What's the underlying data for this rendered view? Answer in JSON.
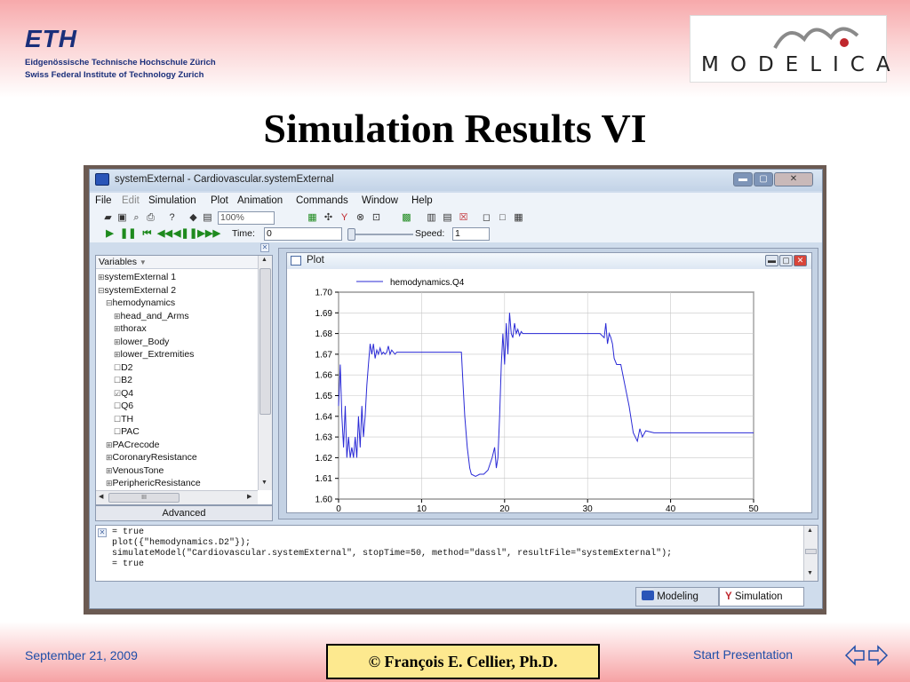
{
  "header": {
    "eth_logo": "ETH",
    "eth_line1": "Eidgenössische Technische Hochschule Zürich",
    "eth_line2": "Swiss Federal Institute of Technology Zurich",
    "modelica_logo": "MODELICA"
  },
  "slide_title": "Simulation Results VI",
  "window": {
    "title": "systemExternal - Cardiovascular.systemExternal",
    "menu": [
      "File",
      "Edit",
      "Simulation",
      "Plot",
      "Animation",
      "Commands",
      "Window",
      "Help"
    ],
    "disabled_menu": "Edit",
    "zoom": "100%",
    "time_label": "Time:",
    "time_value": "0",
    "speed_label": "Speed:",
    "speed_value": "1"
  },
  "variables": {
    "header": "Variables",
    "rows": [
      {
        "label": "systemExternal 1",
        "indent": 0,
        "prefix": "⊞"
      },
      {
        "label": "systemExternal 2",
        "indent": 0,
        "prefix": "⊟"
      },
      {
        "label": "hemodynamics",
        "indent": 1,
        "prefix": "⊟"
      },
      {
        "label": "head_and_Arms",
        "indent": 2,
        "prefix": "⊞"
      },
      {
        "label": "thorax",
        "indent": 2,
        "prefix": "⊞"
      },
      {
        "label": "lower_Body",
        "indent": 2,
        "prefix": "⊞"
      },
      {
        "label": "lower_Extremities",
        "indent": 2,
        "prefix": "⊞"
      },
      {
        "label": "D2",
        "indent": 2,
        "prefix": "☐"
      },
      {
        "label": "B2",
        "indent": 2,
        "prefix": "☐"
      },
      {
        "label": "Q4",
        "indent": 2,
        "prefix": "☑"
      },
      {
        "label": "Q6",
        "indent": 2,
        "prefix": "☐"
      },
      {
        "label": "TH",
        "indent": 2,
        "prefix": "☐"
      },
      {
        "label": "PAC",
        "indent": 2,
        "prefix": "☐"
      },
      {
        "label": "PACrecode",
        "indent": 1,
        "prefix": "⊞"
      },
      {
        "label": "CoronaryResistance",
        "indent": 1,
        "prefix": "⊞"
      },
      {
        "label": "VenousTone",
        "indent": 1,
        "prefix": "⊞"
      },
      {
        "label": "PeriphericResistance",
        "indent": 1,
        "prefix": "⊞"
      }
    ],
    "hscroll_glyph": "III",
    "advanced_label": "Advanced"
  },
  "plot": {
    "window_title": "Plot"
  },
  "chart_data": {
    "type": "line",
    "series": [
      {
        "name": "hemodynamics.Q4",
        "color": "#2a2ad6",
        "x": [
          0,
          0.2,
          0.4,
          0.6,
          0.8,
          1.0,
          1.2,
          1.4,
          1.6,
          1.8,
          2.0,
          2.2,
          2.4,
          2.6,
          2.8,
          3.0,
          3.2,
          3.4,
          3.6,
          3.8,
          4.0,
          4.2,
          4.4,
          4.6,
          4.8,
          5.0,
          5.2,
          5.4,
          5.6,
          5.8,
          6.0,
          6.2,
          6.4,
          6.6,
          6.8,
          7.0,
          7.5,
          8.0,
          9.0,
          10.0,
          11.0,
          12.0,
          13.0,
          14.0,
          14.8,
          15.0,
          15.2,
          15.5,
          15.8,
          16.0,
          16.5,
          17.0,
          17.5,
          18.0,
          18.5,
          18.8,
          19.0,
          19.2,
          19.4,
          19.6,
          19.8,
          20.0,
          20.2,
          20.4,
          20.6,
          20.8,
          21.0,
          21.2,
          21.4,
          21.6,
          21.8,
          22.0,
          22.2,
          22.5,
          23.0,
          24.0,
          26.0,
          28.0,
          30.0,
          31.0,
          31.5,
          32.0,
          32.2,
          32.4,
          32.6,
          32.8,
          33.0,
          33.2,
          33.5,
          34.0,
          34.5,
          35.0,
          35.5,
          36.0,
          36.3,
          36.6,
          37.0,
          38.0,
          40.0,
          45.0,
          50.0
        ],
        "y": [
          1.645,
          1.665,
          1.64,
          1.625,
          1.645,
          1.62,
          1.63,
          1.62,
          1.625,
          1.62,
          1.63,
          1.62,
          1.64,
          1.625,
          1.645,
          1.63,
          1.64,
          1.655,
          1.665,
          1.675,
          1.67,
          1.675,
          1.668,
          1.672,
          1.67,
          1.673,
          1.67,
          1.671,
          1.67,
          1.671,
          1.674,
          1.67,
          1.672,
          1.671,
          1.67,
          1.671,
          1.671,
          1.671,
          1.671,
          1.671,
          1.671,
          1.671,
          1.671,
          1.671,
          1.671,
          1.655,
          1.64,
          1.625,
          1.615,
          1.612,
          1.611,
          1.612,
          1.612,
          1.614,
          1.62,
          1.625,
          1.615,
          1.62,
          1.64,
          1.665,
          1.68,
          1.665,
          1.685,
          1.67,
          1.69,
          1.68,
          1.678,
          1.685,
          1.68,
          1.682,
          1.679,
          1.681,
          1.68,
          1.68,
          1.68,
          1.68,
          1.68,
          1.68,
          1.68,
          1.68,
          1.68,
          1.678,
          1.685,
          1.675,
          1.68,
          1.678,
          1.675,
          1.668,
          1.665,
          1.665,
          1.655,
          1.645,
          1.632,
          1.628,
          1.634,
          1.63,
          1.633,
          1.632,
          1.632,
          1.632,
          1.632
        ]
      }
    ],
    "xlim": [
      0,
      50
    ],
    "ylim": [
      1.6,
      1.7
    ],
    "x_ticks": [
      0,
      10,
      20,
      30,
      40,
      50
    ],
    "y_ticks": [
      1.6,
      1.61,
      1.62,
      1.63,
      1.64,
      1.65,
      1.66,
      1.67,
      1.68,
      1.69,
      1.7
    ],
    "y_tick_labels": [
      "1.60",
      "1.61",
      "1.62",
      "1.63",
      "1.64",
      "1.65",
      "1.66",
      "1.67",
      "1.68",
      "1.69",
      "1.70"
    ],
    "grid": true,
    "legend": "top-left"
  },
  "console": {
    "lines": [
      "= true",
      "plot({\"hemodynamics.D2\"});",
      "simulateModel(\"Cardiovascular.systemExternal\", stopTime=50, method=\"dassl\", resultFile=\"systemExternal\");",
      "= true"
    ]
  },
  "tabs": {
    "modeling": "Modeling",
    "simulation": "Simulation"
  },
  "footer": {
    "date": "September 21, 2009",
    "copyright": "©  François E. Cellier, Ph.D.",
    "start": "Start Presentation"
  }
}
